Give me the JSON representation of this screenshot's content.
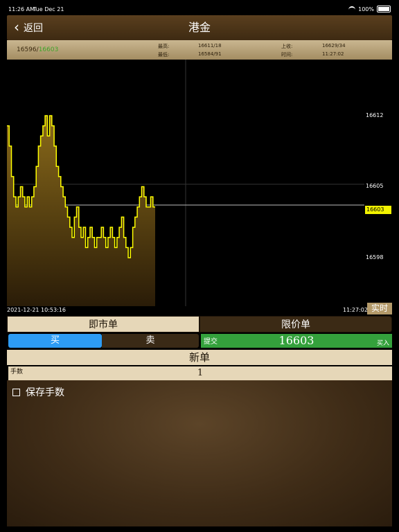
{
  "status": {
    "time": "11:26 AM",
    "date": "Tue Dec 21",
    "battery": "100%"
  },
  "nav": {
    "back_label": "返回",
    "title": "港金"
  },
  "quote": {
    "bid": "16596",
    "ask": "16603",
    "high_label": "最高:",
    "high_value": "16611/18",
    "low_label": "最低:",
    "low_value": "16584/91",
    "prev_label": "上收:",
    "prev_value": "16629/34",
    "time_label": "时间:",
    "time_value": "11:27:02"
  },
  "chart_data": {
    "type": "area",
    "y_ticks": [
      "16612",
      "16605",
      "16598"
    ],
    "current_price": "16603",
    "x_start": "2021-12-21 10:53:16",
    "x_end": "11:27:02",
    "ylim": [
      16595,
      16614
    ],
    "values": [
      16611,
      16609,
      16606,
      16604,
      16603,
      16604,
      16605,
      16604,
      16603,
      16604,
      16603,
      16604,
      16605,
      16607,
      16609,
      16610,
      16611,
      16612,
      16610,
      16612,
      16611,
      16609,
      16607,
      16606,
      16605,
      16604,
      16603,
      16602,
      16601,
      16600,
      16602,
      16603,
      16601,
      16600,
      16601,
      16599,
      16600,
      16601,
      16600,
      16599,
      16600,
      16600,
      16601,
      16600,
      16599,
      16600,
      16601,
      16600,
      16599,
      16600,
      16601,
      16602,
      16600,
      16599,
      16598,
      16599,
      16601,
      16602,
      16603,
      16604,
      16605,
      16604,
      16603,
      16603,
      16604,
      16603
    ],
    "line_color": "#ffff00",
    "fill_color": "#8a6a1a",
    "realtime_label": "实时"
  },
  "order": {
    "market_label": "即市单",
    "limit_label": "限价单",
    "buy_label": "买",
    "sell_label": "卖",
    "submit_label": "提交",
    "submit_price": "16603",
    "submit_side": "买入",
    "new_order_label": "新单",
    "qty_label": "手数",
    "qty_value": "1",
    "save_fee_label": "保存手数"
  }
}
